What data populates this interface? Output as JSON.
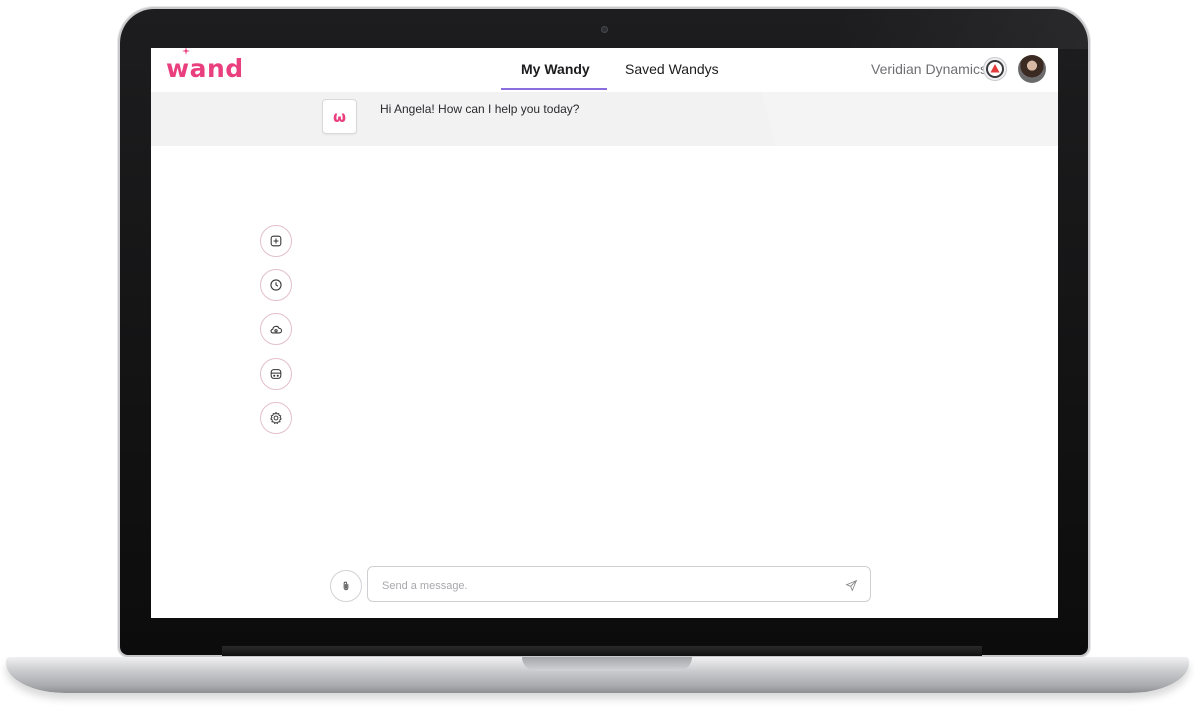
{
  "app": {
    "logo_text": "wand"
  },
  "header": {
    "tabs": [
      {
        "label": "My Wandy",
        "active": true
      },
      {
        "label": "Saved Wandys",
        "active": false
      }
    ],
    "organization": "Veridian Dynamics",
    "accent_color": "#8a6ddf",
    "brand_color": "#e93f7e"
  },
  "chat": {
    "bot_avatar_text": "ω",
    "greeting": "Hi Angela! How can I help you today?"
  },
  "sidebar": {
    "tools": [
      {
        "icon": "new-chat-icon"
      },
      {
        "icon": "history-icon"
      },
      {
        "icon": "cloud-icon"
      },
      {
        "icon": "bot-icon"
      },
      {
        "icon": "settings-icon"
      }
    ]
  },
  "composer": {
    "placeholder": "Send a message."
  }
}
